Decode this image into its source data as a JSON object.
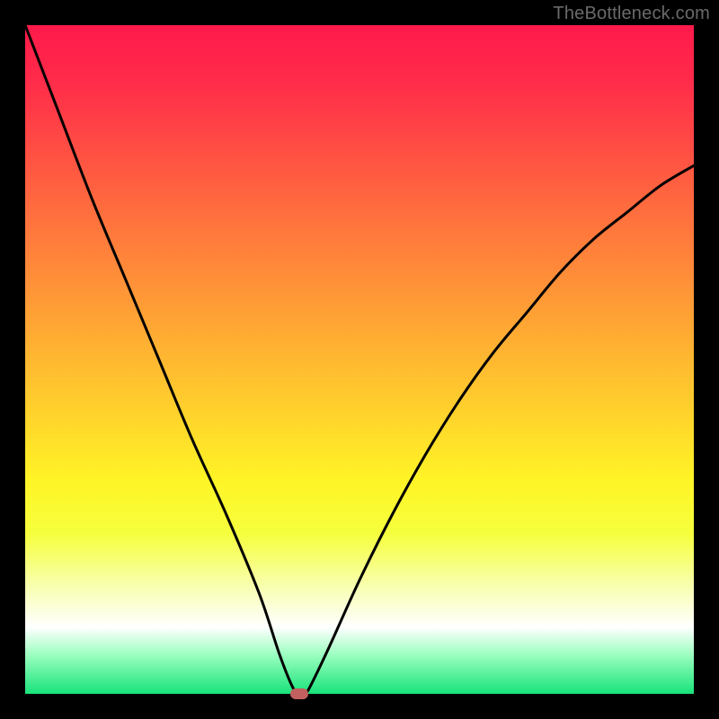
{
  "watermark": "TheBottleneck.com",
  "colors": {
    "frame": "#000000",
    "curve": "#000000",
    "marker": "#c1605f"
  },
  "chart_data": {
    "type": "line",
    "title": "",
    "xlabel": "",
    "ylabel": "",
    "xlim": [
      0,
      100
    ],
    "ylim": [
      0,
      100
    ],
    "grid": false,
    "legend": false,
    "series": [
      {
        "name": "bottleneck-curve",
        "x": [
          0,
          5,
          10,
          15,
          20,
          25,
          30,
          35,
          38,
          40,
          41,
          42,
          45,
          50,
          55,
          60,
          65,
          70,
          75,
          80,
          85,
          90,
          95,
          100
        ],
        "y": [
          100,
          87,
          74,
          62,
          50,
          38,
          27,
          15,
          6,
          1,
          0,
          0,
          6,
          17,
          27,
          36,
          44,
          51,
          57,
          63,
          68,
          72,
          76,
          79
        ]
      }
    ],
    "marker": {
      "x": 41,
      "y": 0
    },
    "background_gradient": {
      "top": "#ff1a4b",
      "mid": "#ffe83a",
      "bottom": "#18e37a"
    }
  }
}
